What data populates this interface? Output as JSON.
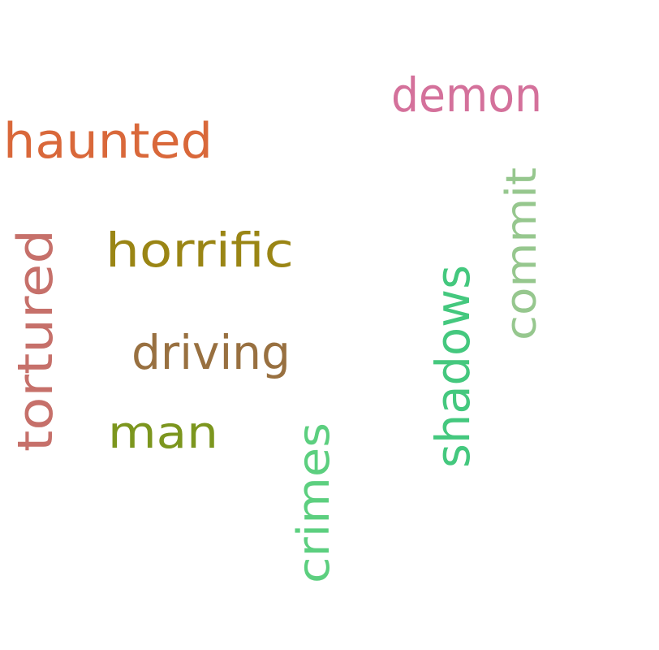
{
  "words": [
    {
      "text": "haunted",
      "color": "#d9683a"
    },
    {
      "text": "demon",
      "color": "#d4719b"
    },
    {
      "text": "commit",
      "color": "#96c78e"
    },
    {
      "text": "horrific",
      "color": "#9a8514"
    },
    {
      "text": "tortured",
      "color": "#c6706a"
    },
    {
      "text": "driving",
      "color": "#987040"
    },
    {
      "text": "shadows",
      "color": "#44c87e"
    },
    {
      "text": "man",
      "color": "#7c961e"
    },
    {
      "text": "crimes",
      "color": "#5ccf7f"
    }
  ]
}
